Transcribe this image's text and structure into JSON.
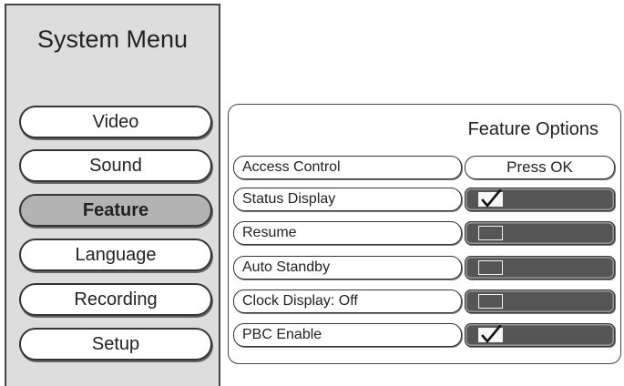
{
  "sidebar": {
    "title": "System Menu",
    "items": [
      {
        "label": "Video",
        "active": false
      },
      {
        "label": "Sound",
        "active": false
      },
      {
        "label": "Feature",
        "active": true
      },
      {
        "label": "Language",
        "active": false
      },
      {
        "label": "Recording",
        "active": false
      },
      {
        "label": "Setup",
        "active": false
      }
    ]
  },
  "panel": {
    "title": "Feature Options",
    "options": [
      {
        "label": "Access Control",
        "value": "Press OK"
      },
      {
        "label": "Status Display",
        "checked": true
      },
      {
        "label": "Resume",
        "checked": false
      },
      {
        "label": "Auto Standby",
        "checked": false
      },
      {
        "label": "Clock Display: Off",
        "checked": false
      },
      {
        "label": "PBC Enable",
        "checked": true
      }
    ]
  },
  "colors": {
    "sidebar_bg": "#dddddd",
    "active_item_bg": "#b3b3b3",
    "value_box_bg": "#555555"
  },
  "icons": {
    "checked": "checkmark-icon",
    "unchecked": "empty-checkbox-icon"
  }
}
